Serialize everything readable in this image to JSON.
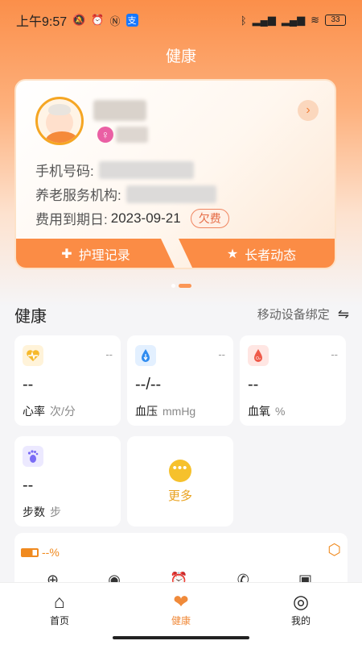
{
  "status_bar": {
    "time": "上午9:57",
    "left_icons": [
      "bell-off",
      "alarm",
      "nfc",
      "alipay"
    ],
    "right_icons": [
      "bluetooth",
      "signal-hd-1",
      "signal-hd-2",
      "wifi"
    ],
    "battery": "33"
  },
  "header": {
    "title": "健康"
  },
  "profile": {
    "phone_label": "手机号码:",
    "org_label": "养老服务机构:",
    "expiry_label": "费用到期日:",
    "expiry_value": "2023-09-21",
    "status_badge": "欠费",
    "care_record_label": "护理记录",
    "elder_news_label": "长者动态"
  },
  "health": {
    "section_title": "健康",
    "bind_device_label": "移动设备绑定",
    "metrics": [
      {
        "name": "heart-rate",
        "icon": "heart-pulse-icon",
        "dash": "--",
        "value": "--",
        "label": "心率",
        "unit": "次/分"
      },
      {
        "name": "blood-pressure",
        "icon": "drop-icon",
        "dash": "--",
        "value": "--/--",
        "label": "血压",
        "unit": "mmHg"
      },
      {
        "name": "blood-oxygen",
        "icon": "oxygen-drop-icon",
        "dash": "--",
        "value": "--",
        "label": "血氧",
        "unit": "%"
      },
      {
        "name": "steps",
        "icon": "footprint-icon",
        "dash": "",
        "value": "--",
        "label": "步数",
        "unit": "步"
      }
    ],
    "more_label": "更多"
  },
  "device": {
    "battery_text": "--%"
  },
  "tabs": [
    {
      "label": "首页"
    },
    {
      "label": "健康"
    },
    {
      "label": "我的"
    }
  ],
  "colors": {
    "accent": "#fb8c45",
    "background": "#f5f5f7",
    "badge_red": "#e56b45",
    "more_yellow": "#f6c12c"
  }
}
